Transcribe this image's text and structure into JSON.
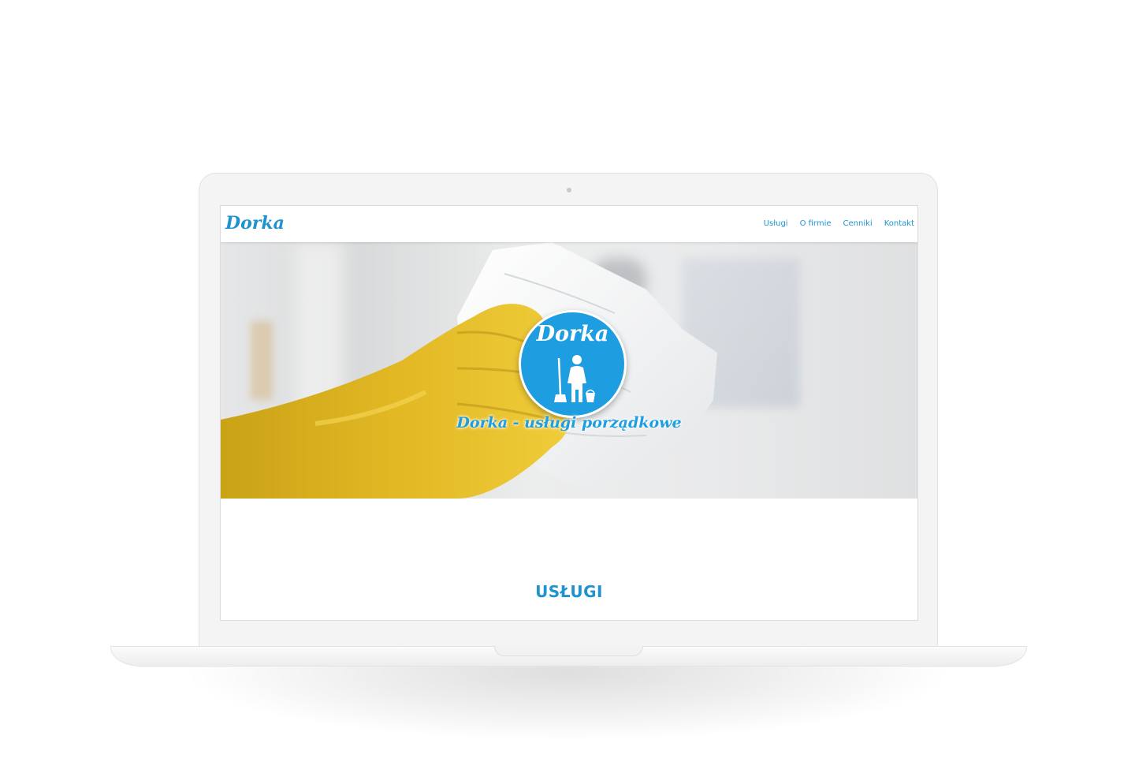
{
  "site": {
    "brand": "Dorka",
    "nav": [
      {
        "label": "Usługi"
      },
      {
        "label": "O firmie"
      },
      {
        "label": "Cenniki"
      },
      {
        "label": "Kontakt"
      }
    ]
  },
  "hero": {
    "badge_title": "Dorka",
    "badge_icon": "maid-with-broom-icon",
    "tagline": "Dorka - usługi porządkowe"
  },
  "services": {
    "heading": "USŁUGI"
  },
  "colors": {
    "accent": "#1e93cf",
    "badge": "#1e9ee0",
    "glove": "#e2b824"
  }
}
